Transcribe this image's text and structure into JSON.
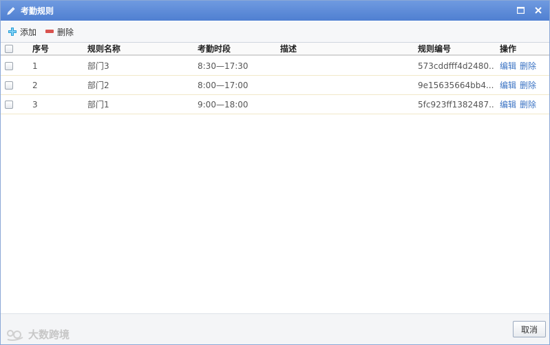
{
  "dialog": {
    "title": "考勤规则",
    "title_icon": "pencil-icon",
    "maximize_icon": "maximize-icon",
    "close_icon": "close-icon"
  },
  "toolbar": {
    "add_label": "添加",
    "add_icon": "plus-icon",
    "delete_label": "删除",
    "delete_icon": "minus-icon"
  },
  "table": {
    "headers": {
      "index": "序号",
      "name": "规则名称",
      "time": "考勤时段",
      "desc": "描述",
      "code": "规则编号",
      "ops": "操作"
    },
    "rows": [
      {
        "index": "1",
        "name": "部门3",
        "time": "8:30—17:30",
        "desc": "",
        "code": "573cddfff4d2480...",
        "edit": "编辑",
        "delete": "删除"
      },
      {
        "index": "2",
        "name": "部门2",
        "time": "8:00—17:00",
        "desc": "",
        "code": "9e15635664bb4...",
        "edit": "编辑",
        "delete": "删除"
      },
      {
        "index": "3",
        "name": "部门1",
        "time": "9:00—18:00",
        "desc": "",
        "code": "5fc923ff1382487...",
        "edit": "编辑",
        "delete": "删除"
      }
    ]
  },
  "footer": {
    "cancel_label": "取消"
  },
  "watermark": {
    "text": "大数跨境"
  },
  "colors": {
    "titlebar": "#5b89d8",
    "link": "#3c74c4",
    "row_border": "#f1e8c8",
    "delete_icon": "#d9534f",
    "add_icon": "#2a9fd6"
  }
}
